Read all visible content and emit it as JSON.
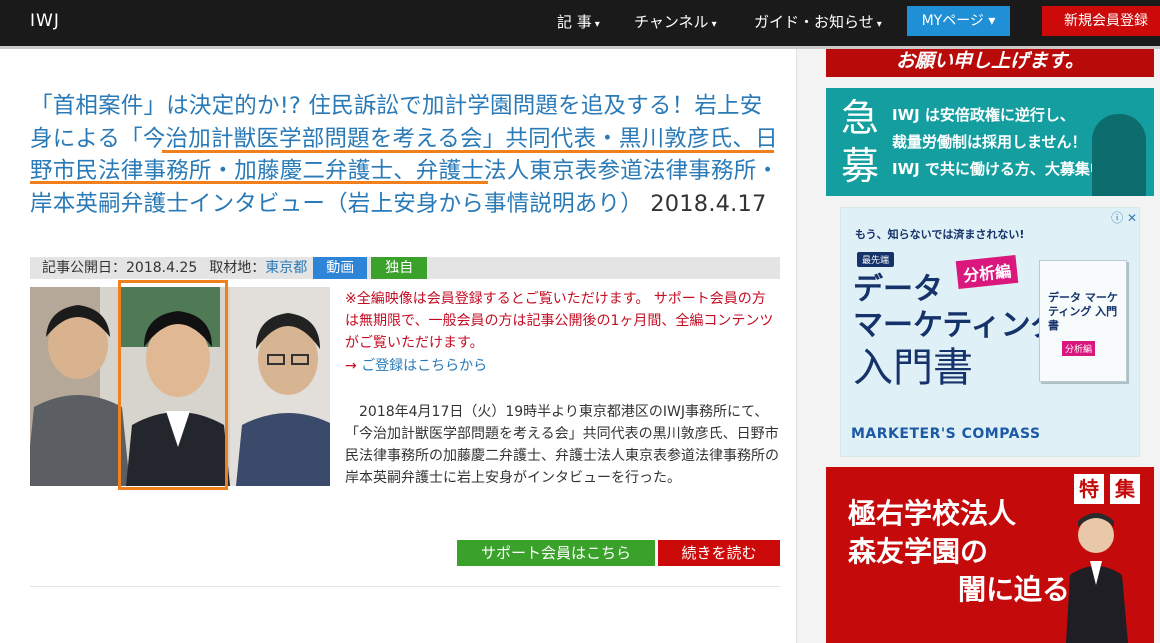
{
  "header": {
    "logo": "IWJ",
    "nav": [
      {
        "label": "記 事"
      },
      {
        "label": "チャンネル"
      },
      {
        "label": "ガイド・お知らせ"
      }
    ],
    "caret": "▾",
    "my_page": "MYページ ▾",
    "register": "新規会員登録"
  },
  "article": {
    "title_prefix": "「首相案件」は決定的か!? 住民訴訟で加計学園問題を追及する！岩上安身による",
    "title_link": "「今治加計獣医学部問題を考える会」共同代表・黒川敦彦氏、日野市民法律事務所・加藤慶二弁護士",
    "title_suffix": "、弁護士法人東京表参道法律事務所・岸本英嗣弁護士インタビュー（岩上安身から事情説明あり）",
    "title_date": " 2018.4.17",
    "meta": {
      "published_label": "記事公開日：",
      "published_date": "2018.4.25",
      "location_label": "取材地：",
      "location": "東京都",
      "tag_video": "動画",
      "tag_exclusive": "独自"
    },
    "notice": "※全編映像は会員登録するとご覧いただけます。 サポート会員の方は無期限で、一般会員の方は記事公開後の1ヶ月間、全編コンテンツがご覧いただけます。",
    "register_arrow": "→ ",
    "register_link": "ご登録はこちらから",
    "body": "2018年4月17日（火）19時半より東京都港区のIWJ事務所にて、「今治加計獣医学部問題を考える会」共同代表の黒川敦彦氏、日野市民法律事務所の加藤慶二弁護士、弁護士法人東京表参道法律事務所の岸本英嗣弁護士に岩上安身がインタビューを行った。",
    "support_button": "サポート会員はこちら",
    "read_more_button": "続きを読む"
  },
  "sidebar": {
    "banner_top": "お願い申し上げます。",
    "recruit": {
      "kanji": [
        "急",
        "募"
      ],
      "lines": [
        "IWJ は安倍政権に逆行し、",
        "裁量労働制は採用しません！",
        "IWJ で共に働ける方、大募集中！"
      ]
    },
    "ad": {
      "close": "ⓘ ✕",
      "subtitle": "もう、知らないでは済まされない!",
      "tag": "最先端",
      "badge": "分析編",
      "title_lines": [
        "データ",
        "マーケティング"
      ],
      "title_big": "入門書",
      "book_title": "データ マーケティング 入門書",
      "book_tag": "分析編",
      "footer": "MARKETER'S COMPASS"
    },
    "feature": {
      "toku": [
        "特",
        "集"
      ],
      "lines": [
        "極右学校法人",
        "森友学園の",
        "闇に迫る"
      ]
    }
  },
  "colors": {
    "header_bg": "#1a1a1a",
    "link_blue": "#2a7ab7",
    "accent_orange": "#f07f1e",
    "notice_red": "#c30d23",
    "button_green": "#3aa12b",
    "button_red": "#cc0a0a",
    "button_blue": "#1f8fd6"
  }
}
